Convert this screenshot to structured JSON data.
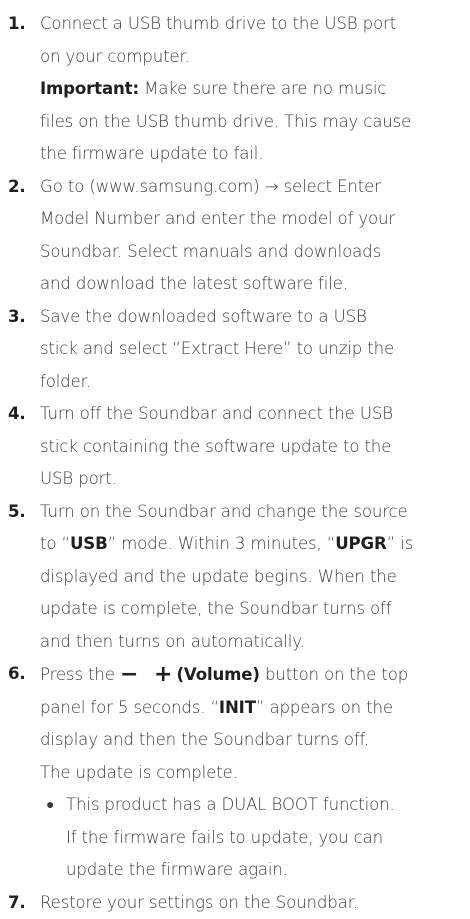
{
  "steps": [
    {
      "num": "1.",
      "lines": [
        "Connect a USB thumb drive to the USB port",
        "on your computer."
      ],
      "important_label": "Important:",
      "important_lines": [
        "Make sure there are no music",
        "files on the USB thumb drive. This may cause",
        "the firmware update to fail."
      ]
    },
    {
      "num": "2.",
      "lines": [
        "Go to (www.samsung.com) → select Enter",
        "Model Number and enter the model of your",
        "Soundbar. Select manuals and downloads",
        "and download the latest software file."
      ]
    },
    {
      "num": "3.",
      "lines": [
        "Save the downloaded software to a USB",
        "stick and select “Extract Here” to unzip the",
        "folder."
      ]
    },
    {
      "num": "4.",
      "lines": [
        "Turn off the Soundbar and connect the USB",
        "stick containing the software update to the",
        "USB port."
      ]
    },
    {
      "num": "5.",
      "line1_a": "Turn on the Soundbar and change the source",
      "line2_a": "to “",
      "line2_usb": "USB",
      "line2_b": "” mode. Within 3 minutes, “",
      "line2_upgr": "UPGR",
      "line2_c": "” is",
      "lines_rest": [
        "displayed and the update begins. When the",
        "update is complete, the Soundbar turns off",
        "and then turns on automatically."
      ]
    },
    {
      "num": "6.",
      "line1_a": "Press the ",
      "line1_symbols": "− +",
      "line1_volume": "(Volume)",
      "line1_b": " button on the top",
      "line2_a": "panel for 5 seconds. “",
      "line2_init": "INIT",
      "line2_b": "” appears on the",
      "lines_rest": [
        "display and then the Soundbar turns off.",
        "The update is complete."
      ],
      "bullet_lines": [
        "This product has a DUAL BOOT function.",
        "If the firmware fails to update, you can",
        "update the firmware again."
      ]
    },
    {
      "num": "7.",
      "lines": [
        "Restore your settings on the Soundbar."
      ]
    }
  ]
}
